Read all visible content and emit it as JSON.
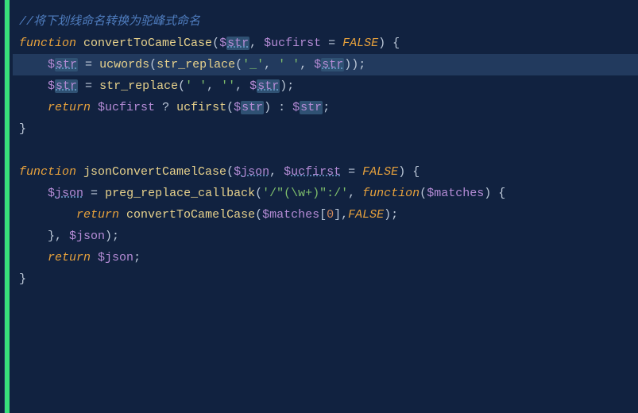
{
  "code": {
    "lines": [
      {
        "hl": false,
        "segments": [
          {
            "cls": "comment",
            "t": "//将下划线命名转换为驼峰式命名"
          }
        ]
      },
      {
        "hl": false,
        "segments": [
          {
            "cls": "kw-func",
            "t": "function"
          },
          {
            "cls": "punc",
            "t": " "
          },
          {
            "cls": "fname",
            "t": "convertToCamelCase"
          },
          {
            "cls": "punc",
            "t": "("
          },
          {
            "cls": "var",
            "t": "$"
          },
          {
            "cls": "var-hl var-ul",
            "t": "str"
          },
          {
            "cls": "punc",
            "t": ", "
          },
          {
            "cls": "var",
            "t": "$ucfirst"
          },
          {
            "cls": "punc",
            "t": " = "
          },
          {
            "cls": "kw-const",
            "t": "FALSE"
          },
          {
            "cls": "punc",
            "t": ") {"
          }
        ]
      },
      {
        "hl": true,
        "segments": [
          {
            "cls": "punc",
            "t": "    "
          },
          {
            "cls": "var",
            "t": "$"
          },
          {
            "cls": "var-hl var-ul",
            "t": "str"
          },
          {
            "cls": "punc",
            "t": " = "
          },
          {
            "cls": "fname",
            "t": "ucwords"
          },
          {
            "cls": "punc",
            "t": "("
          },
          {
            "cls": "fname",
            "t": "str_replace"
          },
          {
            "cls": "punc",
            "t": "("
          },
          {
            "cls": "str",
            "t": "'_'"
          },
          {
            "cls": "punc",
            "t": ", "
          },
          {
            "cls": "str",
            "t": "' '"
          },
          {
            "cls": "punc",
            "t": ", "
          },
          {
            "cls": "var",
            "t": "$"
          },
          {
            "cls": "var-hl var-ul",
            "t": "str"
          },
          {
            "cls": "punc",
            "t": "));"
          }
        ]
      },
      {
        "hl": false,
        "segments": [
          {
            "cls": "punc",
            "t": "    "
          },
          {
            "cls": "var",
            "t": "$"
          },
          {
            "cls": "var-hl var-ul",
            "t": "str"
          },
          {
            "cls": "punc",
            "t": " = "
          },
          {
            "cls": "fname",
            "t": "str_replace"
          },
          {
            "cls": "punc",
            "t": "("
          },
          {
            "cls": "str",
            "t": "' '"
          },
          {
            "cls": "punc",
            "t": ", "
          },
          {
            "cls": "str",
            "t": "''"
          },
          {
            "cls": "punc",
            "t": ", "
          },
          {
            "cls": "var",
            "t": "$"
          },
          {
            "cls": "var-hl var-ul",
            "t": "str"
          },
          {
            "cls": "punc",
            "t": ");"
          }
        ]
      },
      {
        "hl": false,
        "segments": [
          {
            "cls": "punc",
            "t": "    "
          },
          {
            "cls": "kw-ret",
            "t": "return"
          },
          {
            "cls": "punc",
            "t": " "
          },
          {
            "cls": "var",
            "t": "$ucfirst"
          },
          {
            "cls": "punc",
            "t": " ? "
          },
          {
            "cls": "fname",
            "t": "ucfirst"
          },
          {
            "cls": "punc",
            "t": "("
          },
          {
            "cls": "var",
            "t": "$"
          },
          {
            "cls": "var-hl",
            "t": "str"
          },
          {
            "cls": "punc",
            "t": ") : "
          },
          {
            "cls": "var",
            "t": "$"
          },
          {
            "cls": "var-hl",
            "t": "str"
          },
          {
            "cls": "punc",
            "t": ";"
          }
        ]
      },
      {
        "hl": false,
        "segments": [
          {
            "cls": "brace",
            "t": "}"
          }
        ]
      },
      {
        "hl": false,
        "segments": []
      },
      {
        "hl": false,
        "segments": [
          {
            "cls": "kw-func",
            "t": "function"
          },
          {
            "cls": "punc",
            "t": " "
          },
          {
            "cls": "fname",
            "t": "jsonConvertCamelCase"
          },
          {
            "cls": "punc",
            "t": "("
          },
          {
            "cls": "var",
            "t": "$"
          },
          {
            "cls": "var var-ul",
            "t": "json"
          },
          {
            "cls": "punc",
            "t": ", "
          },
          {
            "cls": "var",
            "t": "$"
          },
          {
            "cls": "var var-ul",
            "t": "ucfirst"
          },
          {
            "cls": "punc",
            "t": " = "
          },
          {
            "cls": "kw-const",
            "t": "FALSE"
          },
          {
            "cls": "punc",
            "t": ") {"
          }
        ]
      },
      {
        "hl": false,
        "segments": [
          {
            "cls": "punc",
            "t": "    "
          },
          {
            "cls": "var",
            "t": "$"
          },
          {
            "cls": "var var-ul",
            "t": "json"
          },
          {
            "cls": "punc",
            "t": " = "
          },
          {
            "cls": "fname",
            "t": "preg_replace_callback"
          },
          {
            "cls": "punc",
            "t": "("
          },
          {
            "cls": "str",
            "t": "'/\"(\\w+)\":/'"
          },
          {
            "cls": "punc",
            "t": ", "
          },
          {
            "cls": "kw-func",
            "t": "function"
          },
          {
            "cls": "punc",
            "t": "("
          },
          {
            "cls": "var",
            "t": "$matches"
          },
          {
            "cls": "punc",
            "t": ") {"
          }
        ]
      },
      {
        "hl": false,
        "segments": [
          {
            "cls": "punc",
            "t": "        "
          },
          {
            "cls": "kw-ret",
            "t": "return"
          },
          {
            "cls": "punc",
            "t": " "
          },
          {
            "cls": "fname",
            "t": "convertToCamelCase"
          },
          {
            "cls": "punc",
            "t": "("
          },
          {
            "cls": "var",
            "t": "$matches"
          },
          {
            "cls": "punc",
            "t": "["
          },
          {
            "cls": "num",
            "t": "0"
          },
          {
            "cls": "punc",
            "t": "],"
          },
          {
            "cls": "kw-const",
            "t": "FALSE"
          },
          {
            "cls": "punc",
            "t": ");"
          }
        ]
      },
      {
        "hl": false,
        "segments": [
          {
            "cls": "punc",
            "t": "    }, "
          },
          {
            "cls": "var",
            "t": "$json"
          },
          {
            "cls": "punc",
            "t": ");"
          }
        ]
      },
      {
        "hl": false,
        "segments": [
          {
            "cls": "punc",
            "t": "    "
          },
          {
            "cls": "kw-ret",
            "t": "return"
          },
          {
            "cls": "punc",
            "t": " "
          },
          {
            "cls": "var",
            "t": "$json"
          },
          {
            "cls": "punc",
            "t": ";"
          }
        ]
      },
      {
        "hl": false,
        "segments": [
          {
            "cls": "brace",
            "t": "}"
          }
        ]
      },
      {
        "hl": false,
        "segments": []
      },
      {
        "hl": false,
        "segments": []
      }
    ]
  }
}
